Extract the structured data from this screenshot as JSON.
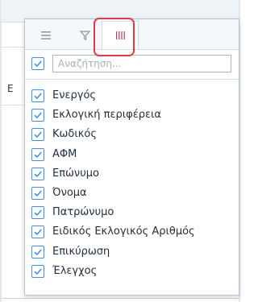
{
  "colors": {
    "accent_blue": "#3f8ee8",
    "tab_active": "#b23b5f",
    "highlight_red": "#e33a46"
  },
  "tabs": [
    {
      "icon": "filter-lines-icon"
    },
    {
      "icon": "funnel-icon"
    },
    {
      "icon": "columns-icon",
      "active": true
    }
  ],
  "search": {
    "placeholder": "Αναζήτηση...",
    "value": "",
    "select_all_checked": true
  },
  "columns": [
    {
      "label": "Ενεργός",
      "checked": true
    },
    {
      "label": "Εκλογική περιφέρεια",
      "checked": true
    },
    {
      "label": "Κωδικός",
      "checked": true
    },
    {
      "label": "ΑΦΜ",
      "checked": true
    },
    {
      "label": "Επώνυμο",
      "checked": true
    },
    {
      "label": "Όνομα",
      "checked": true
    },
    {
      "label": "Πατρώνυμο",
      "checked": true
    },
    {
      "label": "Ειδικός Εκλογικός Αριθμός",
      "checked": true
    },
    {
      "label": "Επικύρωση",
      "checked": true
    },
    {
      "label": "Έλεγχος",
      "checked": true
    }
  ]
}
